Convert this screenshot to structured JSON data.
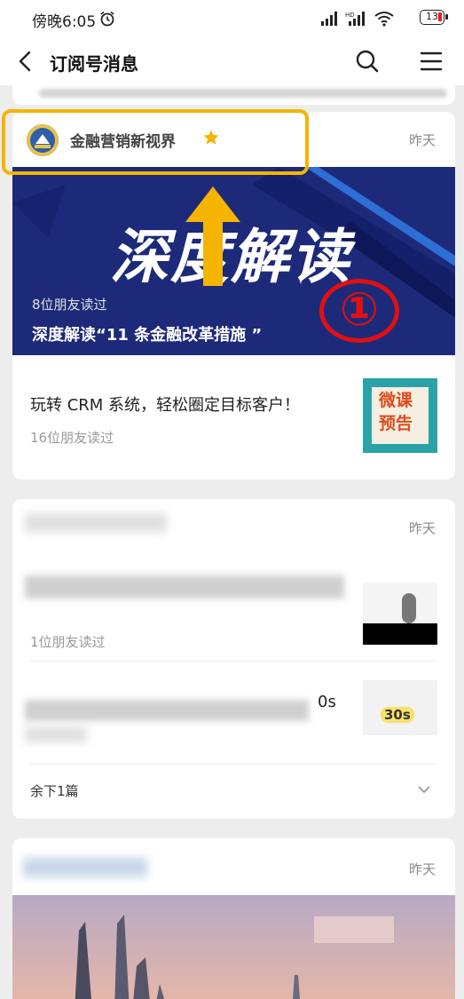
{
  "status_bar": {
    "time": "傍晚6:05",
    "battery": "13",
    "icons": [
      "alarm-icon",
      "signal-icon",
      "wifi-icon",
      "battery-icon"
    ]
  },
  "nav": {
    "title": "订阅号消息",
    "icons": [
      "back-icon",
      "search-icon",
      "menu-icon"
    ]
  },
  "cards": [
    {
      "account": "金融营销新视界",
      "starred": true,
      "date": "昨天",
      "banner_text": "深度解读",
      "lead": {
        "readers": "8位朋友读过",
        "title": "深度解读“11 条金融改革措施 ”"
      },
      "annotation_number": "①",
      "articles": [
        {
          "title": "玩转 CRM 系统，轻松圈定目标客户！",
          "readers": "16位朋友读过",
          "thumb_text": "微课预告"
        }
      ]
    },
    {
      "date": "昨天",
      "articles": [
        {
          "readers": "1位朋友读过"
        },
        {
          "title_fragment": "0s",
          "thumb_text": "30s"
        }
      ],
      "more": "余下1篇"
    },
    {
      "date": "昨天"
    }
  ],
  "colors": {
    "highlight": "#f5b400",
    "annotation_red": "#e01010",
    "banner_bg": "#1d2a7a"
  }
}
